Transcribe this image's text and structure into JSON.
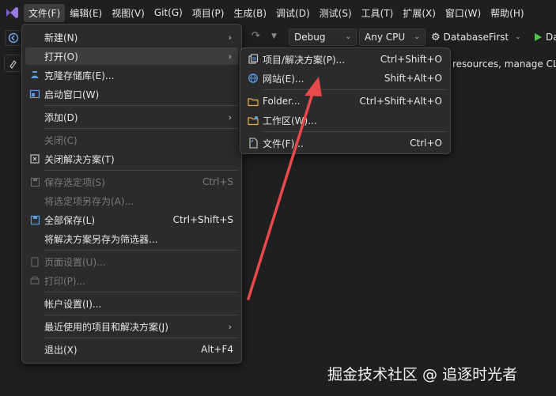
{
  "menubar": {
    "items": [
      {
        "label": "文件(F)"
      },
      {
        "label": "编辑(E)"
      },
      {
        "label": "视图(V)"
      },
      {
        "label": "Git(G)"
      },
      {
        "label": "项目(P)"
      },
      {
        "label": "生成(B)"
      },
      {
        "label": "调试(D)"
      },
      {
        "label": "测试(S)"
      },
      {
        "label": "工具(T)"
      },
      {
        "label": "扩展(X)"
      },
      {
        "label": "窗口(W)"
      },
      {
        "label": "帮助(H)"
      }
    ]
  },
  "toolbar": {
    "configuration": "Debug",
    "platform": "Any CPU",
    "startup_project": "DatabaseFirst",
    "run_label": "Da"
  },
  "second_bar": {
    "text": "resources, manage CLI"
  },
  "file_menu": {
    "items": [
      {
        "label": "新建(N)",
        "shortcut": "",
        "submenu": true,
        "disabled": false,
        "icon": "none"
      },
      {
        "label": "打开(O)",
        "shortcut": "",
        "submenu": true,
        "disabled": false,
        "icon": "none",
        "highlight": true
      },
      {
        "label": "克隆存储库(E)...",
        "shortcut": "",
        "submenu": false,
        "disabled": false,
        "icon": "clone-repo-icon"
      },
      {
        "label": "启动窗口(W)",
        "shortcut": "",
        "submenu": false,
        "disabled": false,
        "icon": "start-window-icon"
      },
      {
        "label": "添加(D)",
        "shortcut": "",
        "submenu": true,
        "disabled": false,
        "icon": "none"
      },
      {
        "label": "关闭(C)",
        "shortcut": "",
        "submenu": false,
        "disabled": true,
        "icon": "none"
      },
      {
        "label": "关闭解决方案(T)",
        "shortcut": "",
        "submenu": false,
        "disabled": false,
        "icon": "close-solution-icon"
      },
      {
        "label": "保存选定项(S)",
        "shortcut": "Ctrl+S",
        "submenu": false,
        "disabled": true,
        "icon": "save-icon"
      },
      {
        "label": "将选定项另存为(A)...",
        "shortcut": "",
        "submenu": false,
        "disabled": true,
        "icon": "none"
      },
      {
        "label": "全部保存(L)",
        "shortcut": "Ctrl+Shift+S",
        "submenu": false,
        "disabled": false,
        "icon": "save-all-icon"
      },
      {
        "label": "将解决方案另存为筛选器...",
        "shortcut": "",
        "submenu": false,
        "disabled": false,
        "icon": "none"
      },
      {
        "label": "页面设置(U)...",
        "shortcut": "",
        "submenu": false,
        "disabled": true,
        "icon": "page-setup-icon"
      },
      {
        "label": "打印(P)...",
        "shortcut": "",
        "submenu": false,
        "disabled": true,
        "icon": "print-icon"
      },
      {
        "label": "帐户设置(I)...",
        "shortcut": "",
        "submenu": false,
        "disabled": false,
        "icon": "none"
      },
      {
        "label": "最近使用的项目和解决方案(J)",
        "shortcut": "",
        "submenu": true,
        "disabled": false,
        "icon": "none"
      },
      {
        "label": "退出(X)",
        "shortcut": "Alt+F4",
        "submenu": false,
        "disabled": false,
        "icon": "none"
      }
    ]
  },
  "open_submenu": {
    "items": [
      {
        "label": "项目/解决方案(P)...",
        "shortcut": "Ctrl+Shift+O",
        "icon": "project-solution-icon"
      },
      {
        "label": "网站(E)...",
        "shortcut": "Shift+Alt+O",
        "icon": "website-icon"
      },
      {
        "label": "Folder...",
        "shortcut": "Ctrl+Shift+Alt+O",
        "icon": "folder-icon"
      },
      {
        "label": "工作区(W)...",
        "shortcut": "",
        "icon": "workspace-icon"
      },
      {
        "label": "文件(F)...",
        "shortcut": "Ctrl+O",
        "icon": "file-icon"
      }
    ]
  },
  "watermark": "掘金技术社区 @ 追逐时光者",
  "colors": {
    "background": "#1f1f1f",
    "menu_bg": "#2b2b2b",
    "highlight": "#3d3d3d",
    "accent_purple": "#8661c5",
    "run_green": "#4ec94e",
    "annotation_arrow": "#e8494a"
  }
}
